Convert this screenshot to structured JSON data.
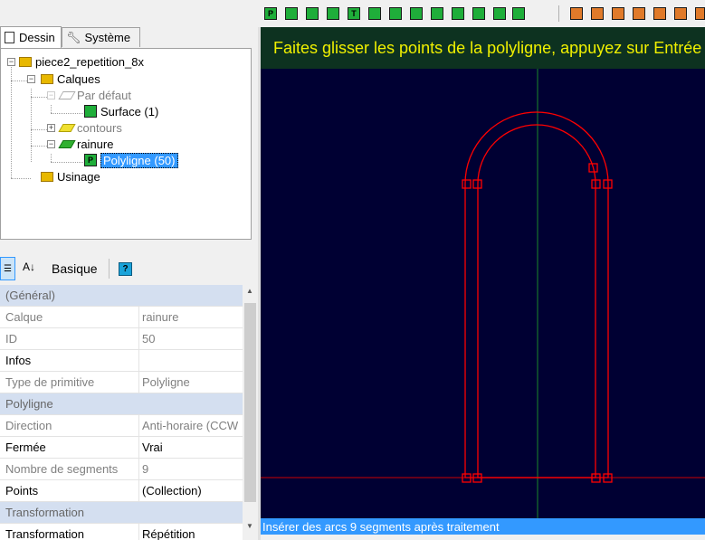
{
  "toolbar": {
    "green_tools": [
      "polyline-icon",
      "circle-icon",
      "dots-icon",
      "rectangle-icon",
      "text-icon",
      "arc-icon",
      "node-icon",
      "box3d-icon",
      "zigzag-icon",
      "lightning-icon",
      "grid-icon",
      "hexagon-icon",
      "polyline-edit-icon"
    ],
    "green_labels": [
      "P",
      "",
      "",
      "",
      "T",
      "",
      "",
      "",
      "",
      "",
      "",
      "",
      ""
    ],
    "orange_tools": [
      "cut-icon",
      "pocket-icon",
      "drill-icon",
      "tool-icon",
      "mill-icon",
      "engrave-icon",
      "chamfer-icon"
    ],
    "colors": {
      "green": "#1fae3a",
      "orange": "#e07a2a"
    }
  },
  "tabs": {
    "dessin": "Dessin",
    "systeme": "Système"
  },
  "tree": {
    "root": "piece2_repetition_8x",
    "calques": "Calques",
    "par_defaut": "Par défaut",
    "surface": "Surface (1)",
    "contours": "contours",
    "rainure": "rainure",
    "polyligne": "Polyligne (50)",
    "usinage": "Usinage"
  },
  "propbar": {
    "basique": "Basique",
    "help": "?"
  },
  "props": {
    "general": "(Général)",
    "calque_k": "Calque",
    "calque_v": "rainure",
    "id_k": "ID",
    "id_v": "50",
    "infos_k": "Infos",
    "infos_v": "",
    "type_k": "Type de primitive",
    "type_v": "Polyligne",
    "polyligne": "Polyligne",
    "direction_k": "Direction",
    "direction_v": "Anti-horaire (CCW",
    "fermee_k": "Fermée",
    "fermee_v": "Vrai",
    "nbseg_k": "Nombre de segments",
    "nbseg_v": "9",
    "points_k": "Points",
    "points_v": "(Collection)",
    "transformation": "Transformation",
    "transf_k": "Transformation",
    "transf_v": "Répétition"
  },
  "canvas": {
    "banner": "Faites glisser les points de la polyligne, appuyez sur Entrée",
    "status": "Insérer des arcs 9 segments après traitement",
    "colors": {
      "background": "#000033",
      "shape": "#ff0000",
      "axis_v": "#1a8a2a",
      "axis_h": "#cc0000"
    }
  }
}
